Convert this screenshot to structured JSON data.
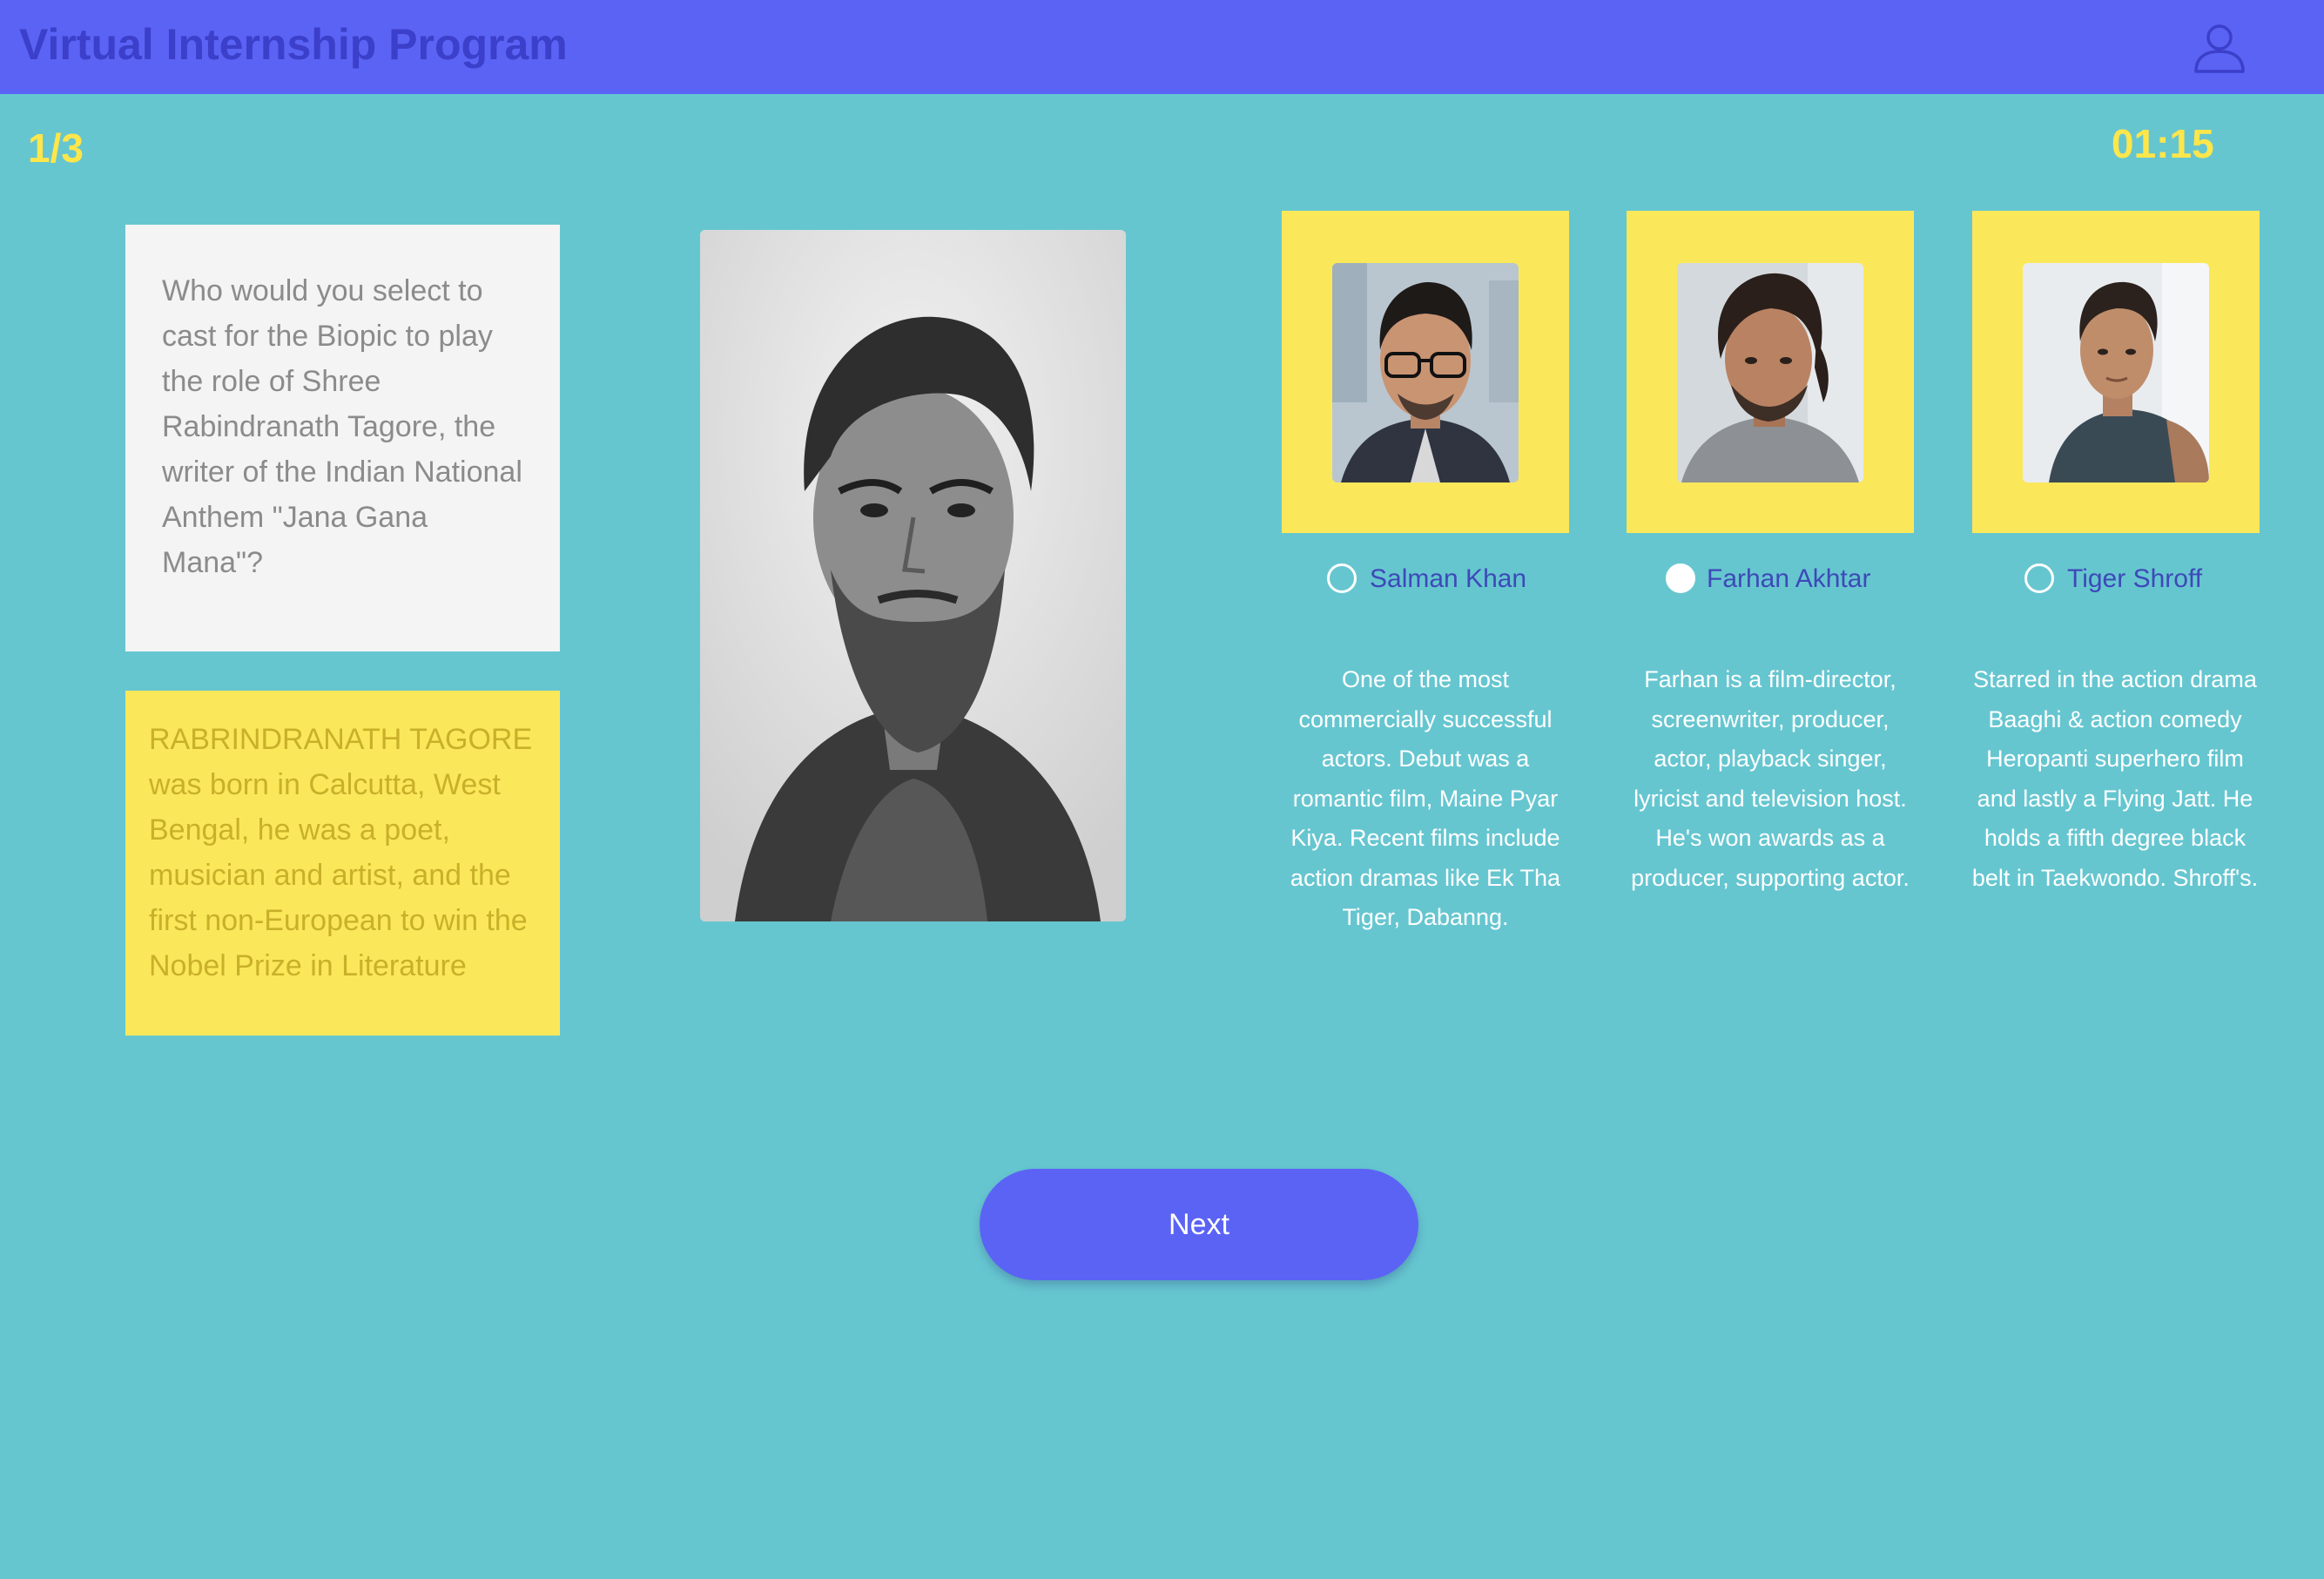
{
  "header": {
    "title": "Virtual Internship Program",
    "user_icon": "user-icon"
  },
  "quiz": {
    "progress": "1/3",
    "timer": "01:15"
  },
  "question": {
    "text": "Who would you select to cast for the Biopic to play the role of Shree Rabindranath Tagore, the writer of the Indian National Anthem \"Jana Gana Mana\"?"
  },
  "info": {
    "text": "RABRINDRANATH TAGORE was born in Calcutta, West Bengal, he was a poet, musician and artist, and the first non-European to win the Nobel Prize in Literature"
  },
  "options": [
    {
      "name": "Salman Khan",
      "selected": false,
      "description": "One of the most commercially successful actors. Debut was a romantic film, Maine Pyar Kiya. Recent films include action dramas like Ek Tha Tiger, Dabanng."
    },
    {
      "name": "Farhan Akhtar",
      "selected": true,
      "description": "Farhan is a film-director, screenwriter, producer, actor, playback singer, lyricist and television host. He's won awards as a producer, supporting actor."
    },
    {
      "name": "Tiger Shroff",
      "selected": false,
      "description": "Starred in the action drama Baaghi & action comedy Heropanti superhero film and lastly a Flying Jatt. He holds a fifth degree black belt in Taekwondo. Shroff's."
    }
  ],
  "actions": {
    "next_label": "Next"
  },
  "colors": {
    "background": "#66c6d0",
    "header": "#5b63f5",
    "accent_yellow": "#fbe85a",
    "title_text": "#3b3fc9"
  }
}
